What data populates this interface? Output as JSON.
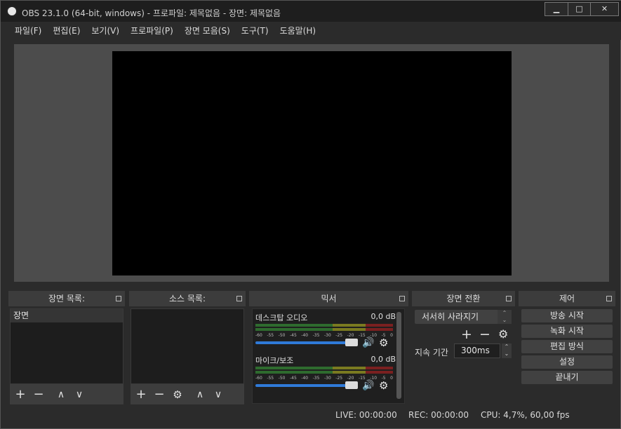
{
  "window": {
    "title": "OBS 23.1.0 (64-bit, windows) - 프로파일: 제목없음 - 장면: 제목없음",
    "minimize": "▁",
    "maximize": "□",
    "close": "✕"
  },
  "menu": [
    "파일(F)",
    "편집(E)",
    "보기(V)",
    "프로파일(P)",
    "장면 모음(S)",
    "도구(T)",
    "도움말(H)"
  ],
  "docks": {
    "scenes": {
      "title": "장면 목록:",
      "items": [
        "장면"
      ]
    },
    "sources": {
      "title": "소스 목록:"
    },
    "mixer": {
      "title": "믹서",
      "channels": [
        {
          "name": "데스크탑 오디오",
          "db": "0,0 dB"
        },
        {
          "name": "마이크/보조",
          "db": "0,0 dB"
        }
      ],
      "ticks": [
        "-60",
        "-55",
        "-50",
        "-45",
        "-40",
        "-35",
        "-30",
        "-25",
        "-20",
        "-15",
        "-10",
        "-5",
        "0"
      ]
    },
    "transitions": {
      "title": "장면 전환",
      "selected": "서서히 사라지기",
      "duration_label": "지속 기간",
      "duration_value": "300ms"
    },
    "controls": {
      "title": "제어",
      "buttons": [
        "방송 시작",
        "녹화 시작",
        "편집 방식",
        "설정",
        "끝내기"
      ]
    }
  },
  "icons": {
    "plus": "+",
    "minus": "−",
    "up": "∧",
    "down": "∨",
    "gear": "⚙",
    "speaker": "🔊"
  },
  "status": {
    "live": "LIVE: 00:00:00",
    "rec": "REC: 00:00:00",
    "cpu": "CPU: 4,7%, 60,00 fps"
  }
}
